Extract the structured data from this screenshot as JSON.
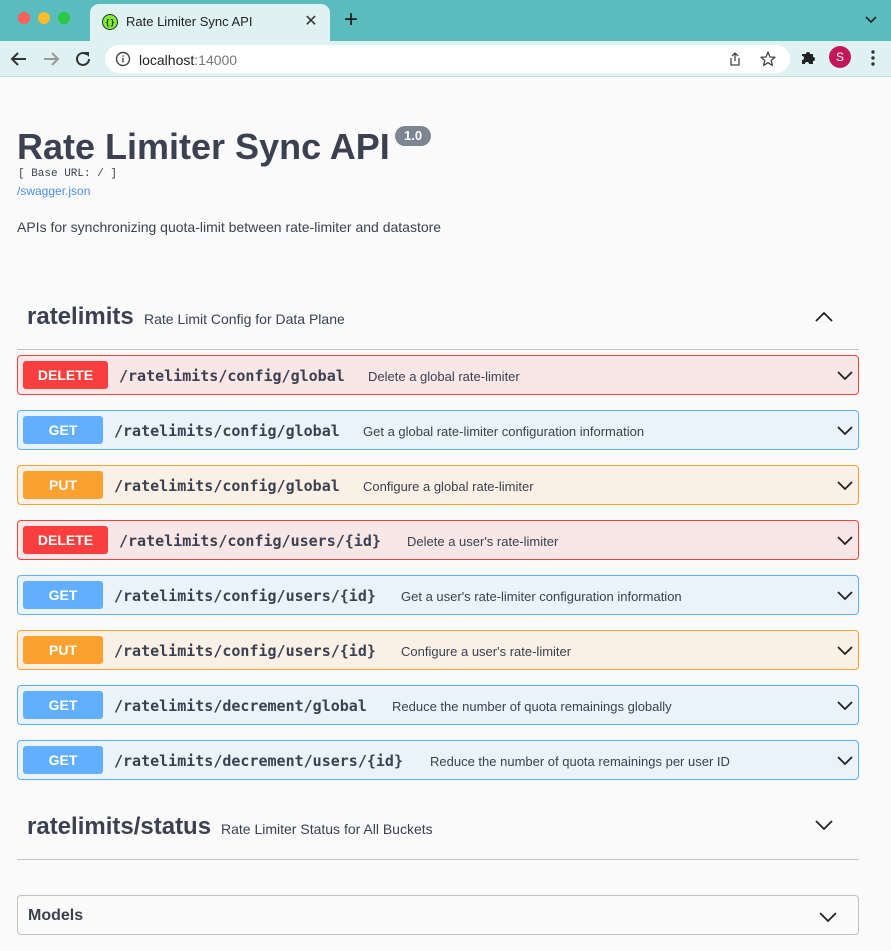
{
  "browser": {
    "tab_title": "Rate Limiter Sync API",
    "url_host": "localhost",
    "url_port": ":14000",
    "avatar_initial": "S"
  },
  "info": {
    "title": "Rate Limiter Sync API",
    "version": "1.0",
    "base_url": "[ Base URL: / ]",
    "spec_link": "/swagger.json",
    "description": "APIs for synchronizing quota-limit between rate-limiter and datastore"
  },
  "tags": [
    {
      "name": "ratelimits",
      "description": "Rate Limit Config for Data Plane",
      "expanded": true,
      "operations": [
        {
          "method": "DELETE",
          "path": "/ratelimits/config/global",
          "summary": "Delete a global rate-limiter"
        },
        {
          "method": "GET",
          "path": "/ratelimits/config/global",
          "summary": "Get a global rate-limiter configuration information"
        },
        {
          "method": "PUT",
          "path": "/ratelimits/config/global",
          "summary": "Configure a global rate-limiter"
        },
        {
          "method": "DELETE",
          "path": "/ratelimits/config/users/{id}",
          "summary": "Delete a user's rate-limiter"
        },
        {
          "method": "GET",
          "path": "/ratelimits/config/users/{id}",
          "summary": "Get a user's rate-limiter configuration information"
        },
        {
          "method": "PUT",
          "path": "/ratelimits/config/users/{id}",
          "summary": "Configure a user's rate-limiter"
        },
        {
          "method": "GET",
          "path": "/ratelimits/decrement/global",
          "summary": "Reduce the number of quota remainings globally"
        },
        {
          "method": "GET",
          "path": "/ratelimits/decrement/users/{id}",
          "summary": "Reduce the number of quota remainings per user ID"
        }
      ]
    },
    {
      "name": "ratelimits/status",
      "description": "Rate Limiter Status for All Buckets",
      "expanded": false
    }
  ],
  "models": {
    "title": "Models"
  },
  "colors": {
    "delete": "#f93e3e",
    "get": "#61affe",
    "put": "#fca130",
    "chrome": "#5bbcbd"
  }
}
